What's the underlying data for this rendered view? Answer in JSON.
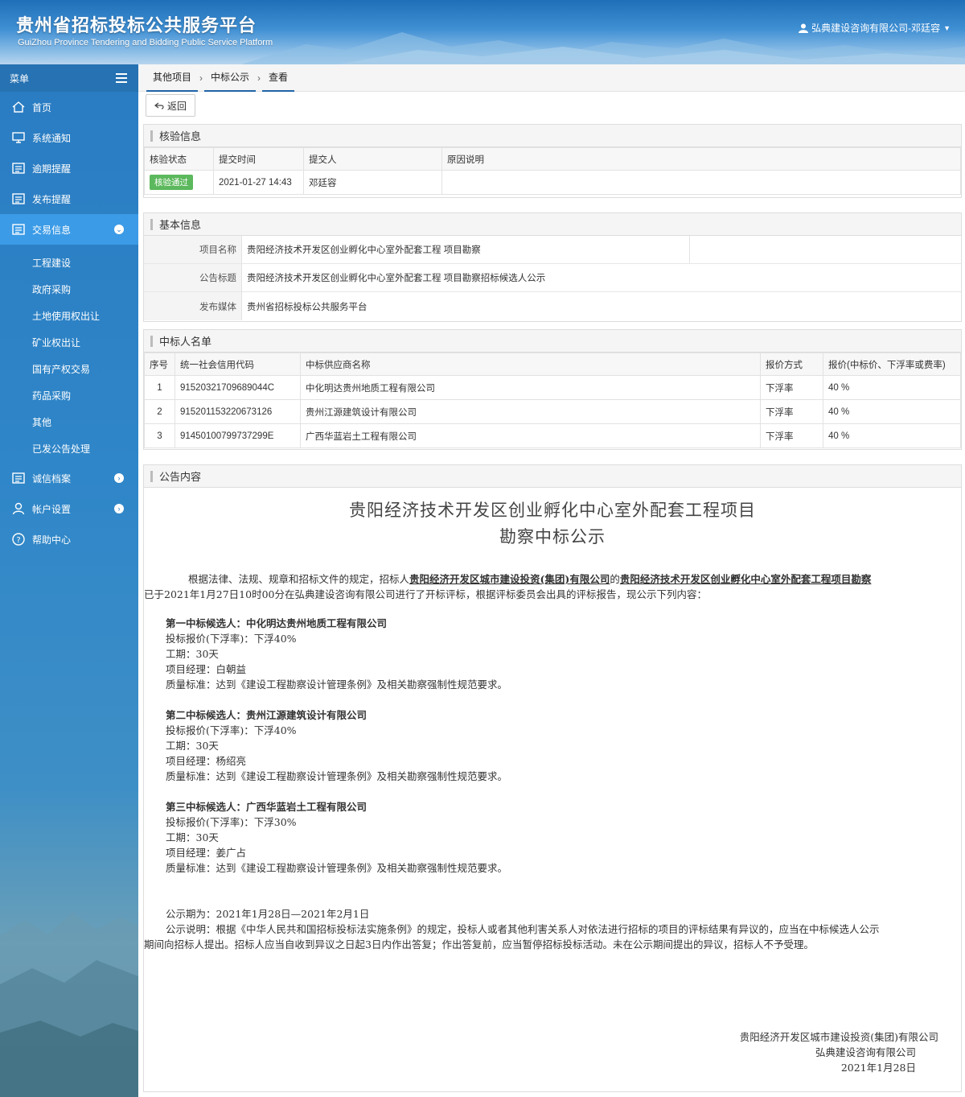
{
  "header": {
    "title_cn": "贵州省招标投标公共服务平台",
    "title_en": "GuiZhou Province Tendering and Bidding Public Service Platform",
    "user": "弘典建设咨询有限公司-邓廷容"
  },
  "sidebar": {
    "menu_label": "菜单",
    "items": [
      {
        "label": "首页",
        "icon": "home-icon"
      },
      {
        "label": "系统通知",
        "icon": "monitor-icon"
      },
      {
        "label": "逾期提醒",
        "icon": "list-icon"
      },
      {
        "label": "发布提醒",
        "icon": "list-icon"
      },
      {
        "label": "交易信息",
        "icon": "list-icon",
        "active": true
      }
    ],
    "sub_items": [
      "工程建设",
      "政府采购",
      "土地使用权出让",
      "矿业权出让",
      "国有产权交易",
      "药品采购",
      "其他",
      "已发公告处理"
    ],
    "items_after": [
      {
        "label": "诚信档案",
        "icon": "list-icon"
      },
      {
        "label": "帐户设置",
        "icon": "user-icon"
      },
      {
        "label": "帮助中心",
        "icon": "help-icon"
      }
    ]
  },
  "breadcrumb": [
    "其他项目",
    "中标公示",
    "查看"
  ],
  "back_button": "返回",
  "verify": {
    "title": "核验信息",
    "headers": [
      "核验状态",
      "提交时间",
      "提交人",
      "原因说明"
    ],
    "status": "核验通过",
    "time": "2021-01-27 14:43",
    "submitter": "邓廷容",
    "reason": ""
  },
  "basic": {
    "title": "基本信息",
    "project_name_label": "项目名称",
    "project_name": "贵阳经济技术开发区创业孵化中心室外配套工程 项目勘察",
    "notice_title_label": "公告标题",
    "notice_title": "贵阳经济技术开发区创业孵化中心室外配套工程 项目勘察招标候选人公示",
    "media_label": "发布媒体",
    "media": "贵州省招标投标公共服务平台"
  },
  "winners": {
    "title": "中标人名单",
    "headers": [
      "序号",
      "统一社会信用代码",
      "中标供应商名称",
      "报价方式",
      "报价(中标价、下浮率或费率)"
    ],
    "rows": [
      {
        "no": "1",
        "code": "91520321709689044C",
        "name": "中化明达贵州地质工程有限公司",
        "method": "下浮率",
        "price": "40 %"
      },
      {
        "no": "2",
        "code": "915201153220673126",
        "name": "贵州江源建筑设计有限公司",
        "method": "下浮率",
        "price": "40 %"
      },
      {
        "no": "3",
        "code": "91450100799737299E",
        "name": "广西华蓝岩土工程有限公司",
        "method": "下浮率",
        "price": "40 %"
      }
    ]
  },
  "notice": {
    "section_title": "公告内容",
    "title_line1": "贵阳经济技术开发区创业孵化中心室外配套工程项目",
    "title_line2": "勘察中标公示",
    "intro_a": "根据法律、法规、规章和招标文件的规定，招标人",
    "intro_tenderer": "贵阳经济开发区城市建设投资(集团)有限公司",
    "intro_b": "的",
    "intro_project": "贵阳经济技术开发区创业孵化中心室外配套工程项目勘察",
    "intro_c": "已于2021年1月27日10时00分在弘典建设咨询有限公司进行了开标评标，根据评标委员会出具的评标报告，现公示下列内容：",
    "candidates": [
      {
        "head": "第一中标候选人：中化明达贵州地质工程有限公司",
        "price": "投标报价(下浮率)：下浮40%",
        "period": "工期：30天",
        "manager": "项目经理：白朝益",
        "quality": "质量标准：达到《建设工程勘察设计管理条例》及相关勘察强制性规范要求。"
      },
      {
        "head": "第二中标候选人：贵州江源建筑设计有限公司",
        "price": "投标报价(下浮率)：下浮40%",
        "period": "工期：30天",
        "manager": "项目经理：杨绍亮",
        "quality": "质量标准：达到《建设工程勘察设计管理条例》及相关勘察强制性规范要求。"
      },
      {
        "head": "第三中标候选人：广西华蓝岩土工程有限公司",
        "price": "投标报价(下浮率)：下浮30%",
        "period": "工期：30天",
        "manager": "项目经理：姜广占",
        "quality": "质量标准：达到《建设工程勘察设计管理条例》及相关勘察强制性规范要求。"
      }
    ],
    "period": "公示期为：2021年1月28日—2021年2月1日",
    "statement_a": "公示说明：根据《中华人民共和国招标投标法实施条例》的规定，投标人或者其他利害关系人对依法进行招标的项目的评标结果有异议的，应当在中标候选人公示",
    "statement_b": "期间向招标人提出。招标人应当自收到异议之日起3日内作出答复；作出答复前，应当暂停招标投标活动。未在公示期间提出的异议，招标人不予受理。",
    "sign1": "贵阳经济开发区城市建设投资(集团)有限公司",
    "sign2": "弘典建设咨询有限公司",
    "sign_date": "2021年1月28日"
  },
  "colors": {
    "header": "#2a78c2",
    "sidebar_active": "#3b9be6",
    "badge": "#5cb85c"
  }
}
